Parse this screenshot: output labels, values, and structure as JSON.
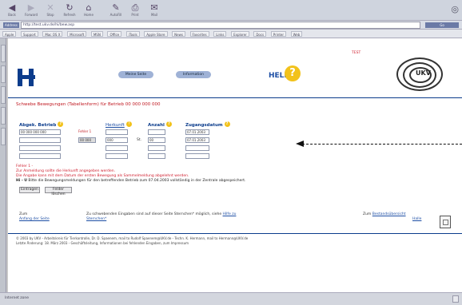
{
  "browser": {
    "toolbar": [
      {
        "label": "Back",
        "icon": "back-arrow-icon",
        "disabled": false
      },
      {
        "label": "Forward",
        "icon": "forward-arrow-icon",
        "disabled": true
      },
      {
        "label": "Stop",
        "icon": "stop-icon",
        "disabled": true
      },
      {
        "label": "Refresh",
        "icon": "refresh-icon",
        "disabled": false
      },
      {
        "label": "Home",
        "icon": "home-icon",
        "disabled": false
      },
      {
        "label": "AutoFill",
        "icon": "autofill-icon",
        "disabled": false
      },
      {
        "label": "Print",
        "icon": "print-icon",
        "disabled": false
      },
      {
        "label": "Mail",
        "icon": "mail-icon",
        "disabled": false
      }
    ],
    "address_label": "Address",
    "address_value": "http://test.ukv.de/hi/bew.asp",
    "go_label": "Go",
    "bookmarks": [
      "Apple",
      "Support",
      "Mac OS X",
      "Microsoft",
      "MSN",
      "Office",
      "iTools",
      "Apple Store",
      "News",
      "Favorites",
      "Links",
      "Explorer",
      "Docs",
      "Printer",
      "Web"
    ],
    "status": "Internet zone"
  },
  "header": {
    "nav_left": "Meine Seite",
    "nav_right": "Information",
    "help_text": "HELP",
    "help_symbol": "?",
    "test_label": "TEST",
    "brand": "UKV"
  },
  "form": {
    "heading": "Schwebe Bewegungen (Tabellenform) für Betrieb 00 000 000 000",
    "columns": {
      "c1": "Abgek. Betrieb",
      "c2": "Herkunft",
      "c3": "Anzahl",
      "c4": "Zugangsdatum"
    },
    "fehler_label": "Fehler 1",
    "unit": "St.",
    "rows": [
      {
        "c1": "00 000 000 000",
        "c2": "",
        "c3": "",
        "c4": "",
        "c5": "07.01.2003"
      },
      {
        "c1": "",
        "c2": "00 000",
        "c3": "000",
        "c4": "00",
        "c5": "07.01.2003"
      },
      {
        "c1": "",
        "c2": "",
        "c3": "",
        "c4": "",
        "c5": ""
      },
      {
        "c1": "",
        "c2": "",
        "c3": "",
        "c4": "",
        "c5": ""
      }
    ],
    "errors": [
      "Fehler 1 -",
      "Zur Anmeldung sollte die Herkunft angegeben werden.",
      "Die Angabe kann mit dem Datum der ersten Bewegung als Sammelmeldung abgelehnt werden."
    ],
    "note": "Bitte die Bewegungsmeldungen für den betreffenden Betrieb zum 07.04.2003 vollständig in der Zentrale abgespeichert.",
    "note_prefix": "Hi - U",
    "note_bold_date": "07.04.2003",
    "buttons": {
      "submit": "Eintragen",
      "reset": "Felder löschen"
    }
  },
  "footer_links": {
    "top_left_1": "Zum",
    "top_left_2": "Anfang der Seite",
    "middle_1": "Zu schwebenden Eingaben sind auf dieser Seite Sternchen* möglich, siehe",
    "middle_link": "Hilfe zu",
    "middle_2": "Sternchen*",
    "right_1": "Zum",
    "right_link": "Bestandsübersicht",
    "right_2": "Halle"
  },
  "footer": {
    "line1": "© 2003 by UKV - Arbeitskreis für Tierkontrolle, Dr. D. Spaenem, mail to Rudolf Spaenem@UKV.de - Techn. K. Hermann, mail to Hermann@UKV.de",
    "line2": "Letzte Änderung: 18. März 2003 - Geschäftsleitung, Informationen bei fehlenden Eingaben, zum Impressum"
  }
}
